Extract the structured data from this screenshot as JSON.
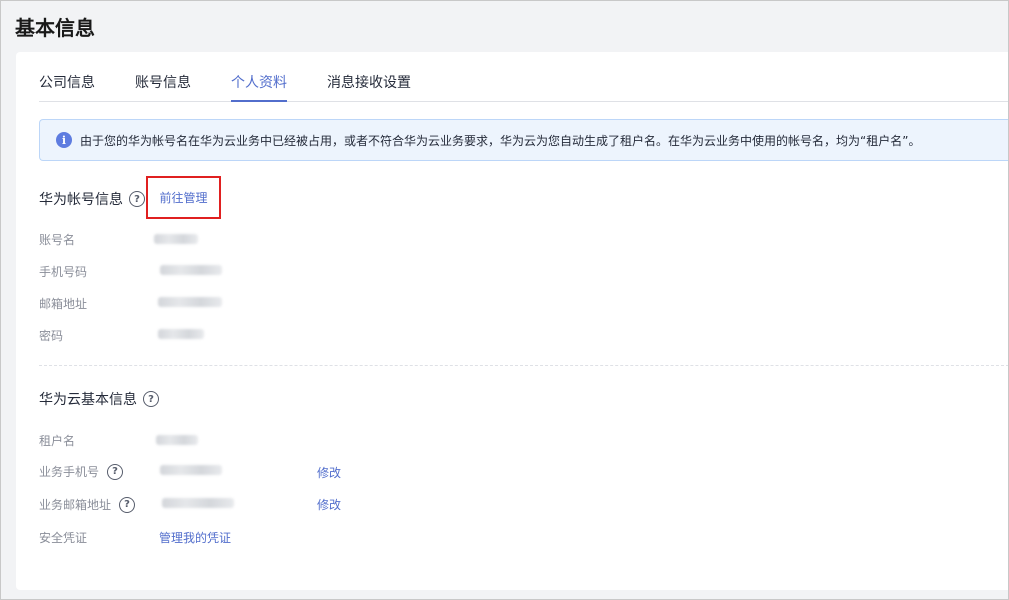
{
  "page": {
    "title": "基本信息"
  },
  "tabs": [
    {
      "label": "公司信息",
      "active": false
    },
    {
      "label": "账号信息",
      "active": false
    },
    {
      "label": "个人资料",
      "active": true
    },
    {
      "label": "消息接收设置",
      "active": false
    }
  ],
  "notice": {
    "text": "由于您的华为帐号名在华为云业务中已经被占用，或者不符合华为云业务要求，华为云为您自动生成了租户名。在华为云业务中使用的帐号名，均为“租户名”。"
  },
  "huawei_account": {
    "title": "华为帐号信息",
    "manage_link": "前往管理",
    "fields": [
      {
        "label": "账号名"
      },
      {
        "label": "手机号码"
      },
      {
        "label": "邮箱地址"
      },
      {
        "label": "密码"
      }
    ]
  },
  "cloud_basic": {
    "title": "华为云基本信息",
    "fields": [
      {
        "label": "租户名"
      },
      {
        "label": "业务手机号",
        "action": "修改"
      },
      {
        "label": "业务邮箱地址",
        "action": "修改"
      },
      {
        "label": "安全凭证",
        "action": "管理我的凭证"
      }
    ]
  },
  "colors": {
    "accent": "#526ecc",
    "highlight_border": "#e02020",
    "notice_bg": "#edf4fd"
  },
  "icons": {
    "info": "info-icon",
    "help": "question-circle-icon"
  }
}
